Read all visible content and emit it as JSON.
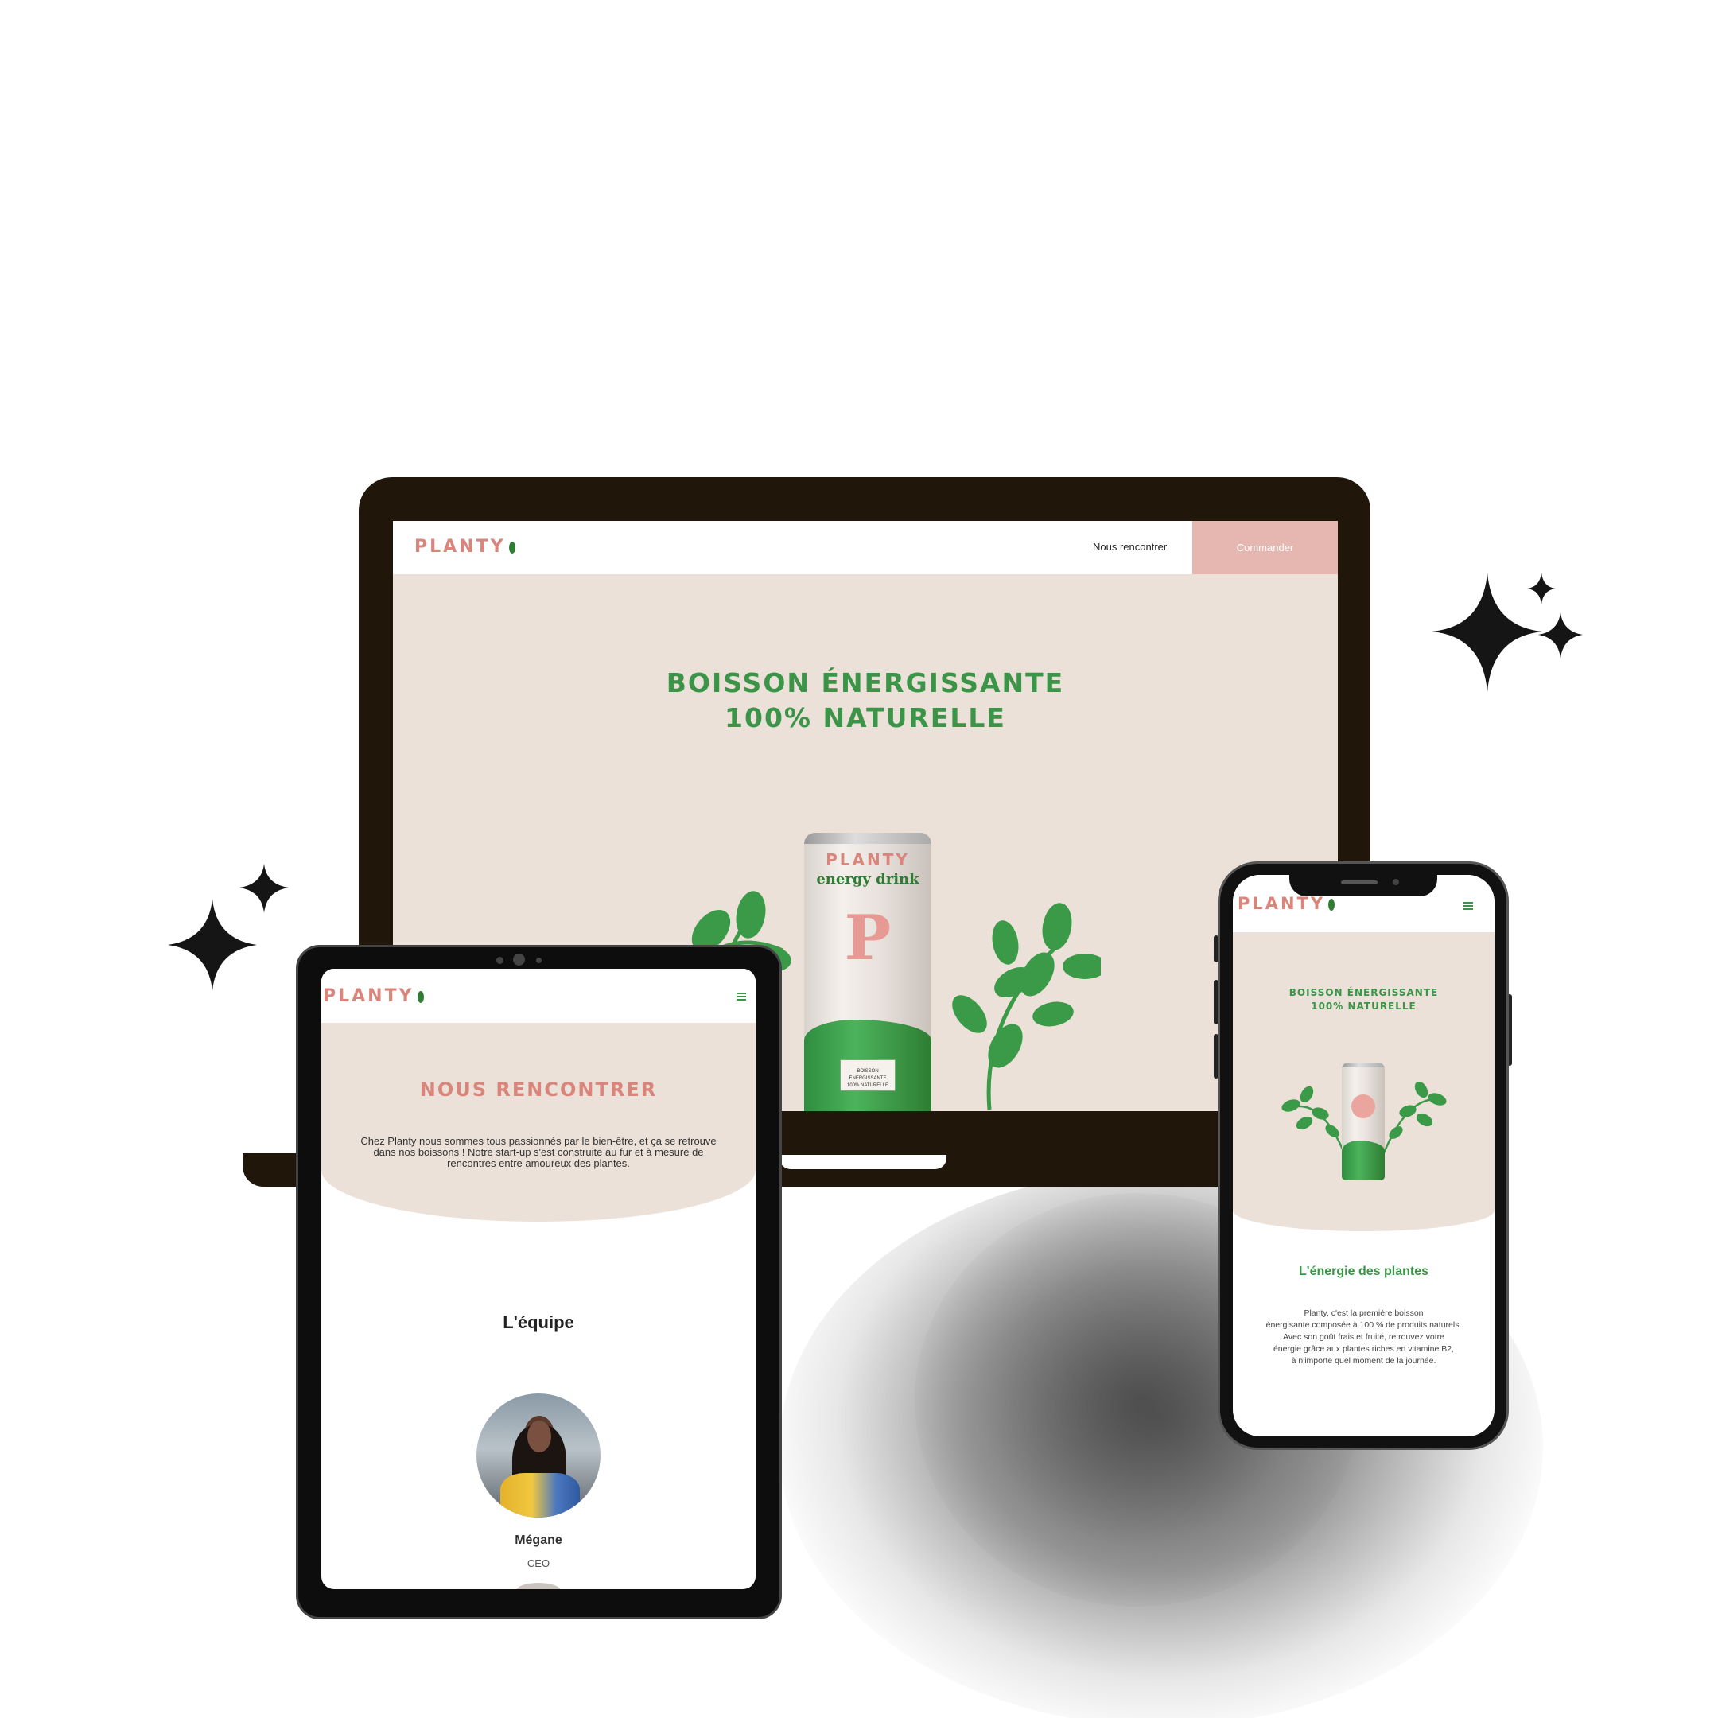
{
  "desktop": {
    "logo": "PLANTY",
    "nav_link": "Nous rencontrer",
    "order_button": "Commander",
    "hero_line1": "BOISSON ÉNERGISSANTE",
    "hero_line2": "100% NATURELLE",
    "can_brand": "PLANTY",
    "can_subtitle": "energy drink",
    "can_letter": "P",
    "can_label_line1": "BOISSON ÉNERGISSANTE",
    "can_label_line2": "100% NATURELLE"
  },
  "tablet": {
    "logo": "PLANTY",
    "menu_icon": "hamburger-icon",
    "page_title": "NOUS RENCONTRER",
    "intro_line1": "Chez Planty nous sommes tous passionnés par le bien-être, et ça se retrouve",
    "intro_line2": "dans nos boissons ! Notre start-up s'est construite au fur et à mesure de",
    "intro_line3": "rencontres entre amoureux des plantes.",
    "team_heading": "L'équipe",
    "member_name": "Mégane",
    "member_role": "CEO"
  },
  "phone": {
    "logo": "PLANTY",
    "menu_icon": "hamburger-icon",
    "hero_line1": "BOISSON ÉNERGISSANTE",
    "hero_line2": "100% NATURELLE",
    "section_title": "L'énergie des plantes",
    "body_line1": "Planty, c'est la première boisson",
    "body_line2": "énergisante composée à 100 % de produits naturels.",
    "body_line3": "Avec son goût frais et fruité, retrouvez votre",
    "body_line4": "énergie grâce aux plantes riches en vitamine B2,",
    "body_line5": "à n'importe quel moment de la journée."
  },
  "colors": {
    "brand_pink": "#d9857c",
    "brand_green": "#3b9447",
    "hero_bg": "#ebe1d8",
    "button_pink": "#e5b7b0",
    "device_frame": "#201609"
  }
}
